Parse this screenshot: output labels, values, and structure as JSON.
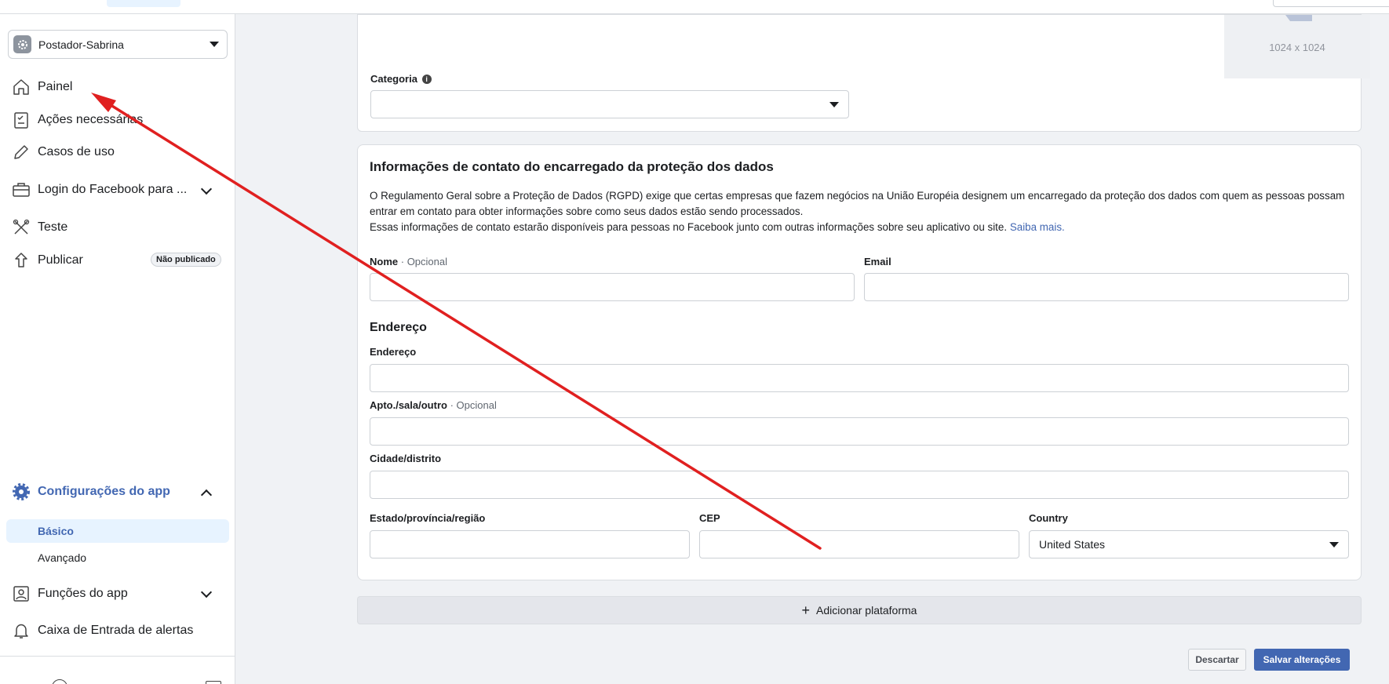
{
  "app_selector": {
    "name": "Postador-Sabrina"
  },
  "sidebar": {
    "items": [
      {
        "label": "Painel"
      },
      {
        "label": "Ações necessárias"
      },
      {
        "label": "Casos de uso"
      },
      {
        "label": "Login do Facebook para ..."
      },
      {
        "label": "Teste"
      },
      {
        "label": "Publicar",
        "badge": "Não publicado"
      }
    ],
    "settings": {
      "label": "Configurações do app",
      "sub_items": [
        {
          "label": "Básico"
        },
        {
          "label": "Avançado"
        }
      ]
    },
    "roles": {
      "label": "Funções do app"
    },
    "alerts": {
      "label": "Caixa de Entrada de alertas"
    }
  },
  "icon_panel": {
    "image_size": "1024 x 1024",
    "category_label": "Categoria",
    "category_value": ""
  },
  "dpo": {
    "title": "Informações de contato do encarregado da proteção dos dados",
    "description_1": "O Regulamento Geral sobre a Proteção de Dados (RGPD) exige que certas empresas que fazem negócios na União Européia designem um encarregado da proteção dos dados com quem as pessoas possam entrar em contato para obter informações sobre como seus dados estão sendo processados.",
    "description_2": "Essas informações de contato estarão disponíveis para pessoas no Facebook junto com outras informações sobre seu aplicativo ou site.",
    "learn_more": "Saiba mais.",
    "name_label": "Nome",
    "optional": "· Opcional",
    "email_label": "Email",
    "address_heading": "Endereço",
    "address_label": "Endereço",
    "apt_label": "Apto./sala/outro",
    "city_label": "Cidade/distrito",
    "state_label": "Estado/província/região",
    "zip_label": "CEP",
    "country_label": "Country",
    "country_value": "United States"
  },
  "actions": {
    "add_platform": "Adicionar plataforma",
    "discard": "Descartar",
    "save": "Salvar alterações"
  },
  "annotation": {
    "color": "#e02020"
  }
}
